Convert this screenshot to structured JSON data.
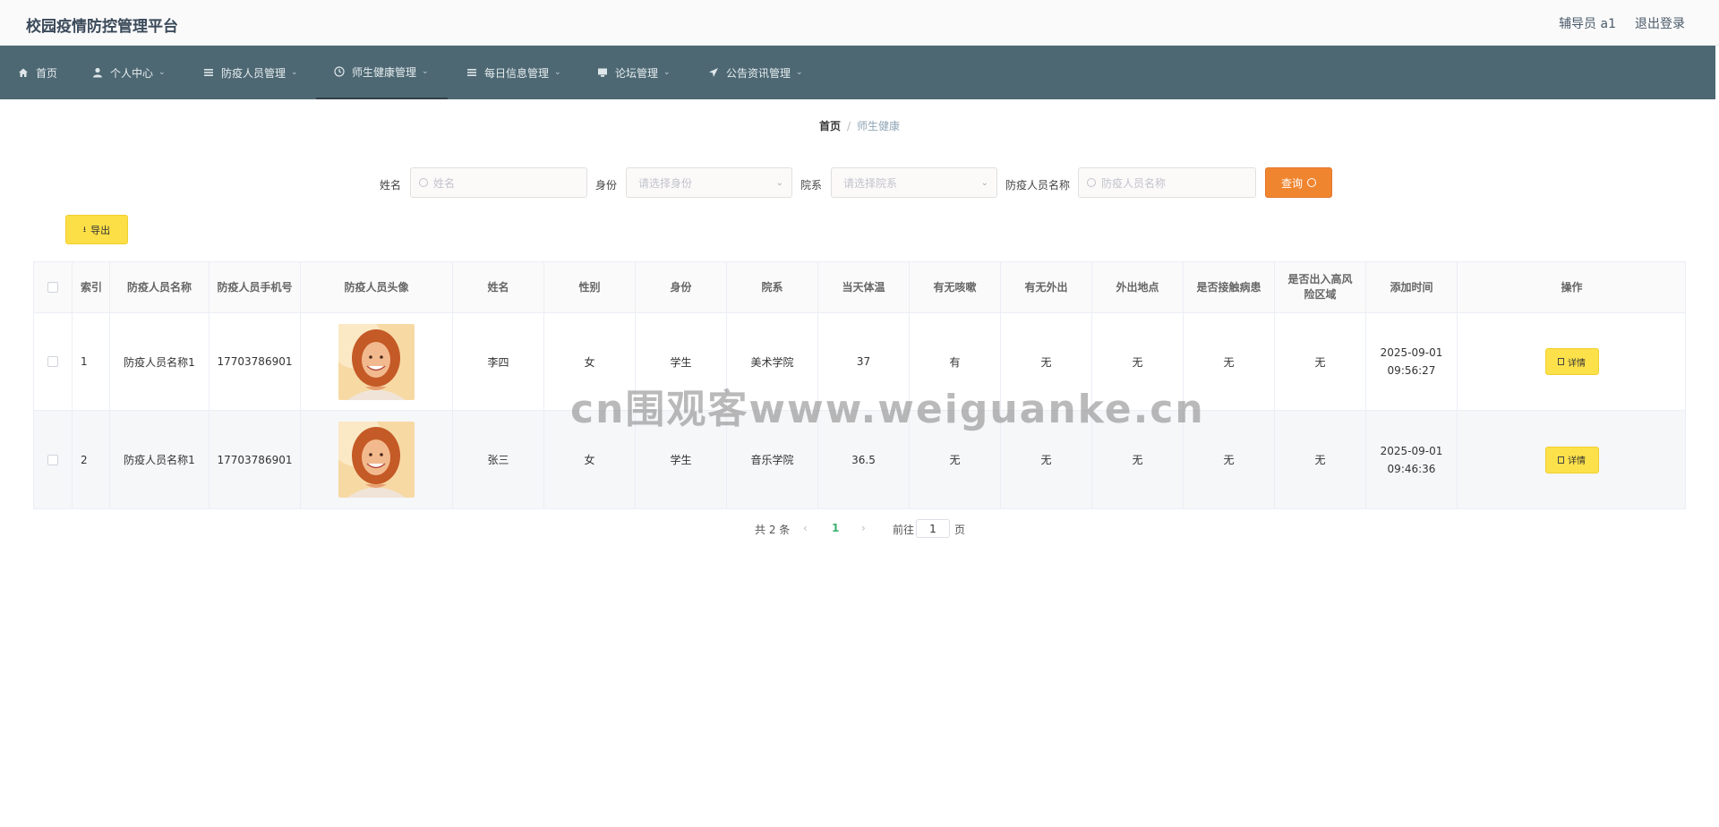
{
  "app": {
    "title": "校园疫情防控管理平台"
  },
  "header": {
    "user": "辅导员 a1",
    "logout": "退出登录"
  },
  "nav": {
    "items": [
      {
        "label": "首页",
        "icon": "home-icon"
      },
      {
        "label": "个人中心",
        "icon": "user-icon"
      },
      {
        "label": "防疫人员管理",
        "icon": "list-icon"
      },
      {
        "label": "师生健康管理",
        "icon": "clock-icon"
      },
      {
        "label": "每日信息管理",
        "icon": "list-icon"
      },
      {
        "label": "论坛管理",
        "icon": "monitor-icon"
      },
      {
        "label": "公告资讯管理",
        "icon": "send-icon"
      }
    ],
    "active_index": 3
  },
  "breadcrumb": {
    "home": "首页",
    "separator": "/",
    "current": "师生健康"
  },
  "search": {
    "name_label": "姓名",
    "name_placeholder": "姓名",
    "identity_label": "身份",
    "identity_placeholder": "请选择身份",
    "college_label": "院系",
    "college_placeholder": "请选择院系",
    "staff_label": "防疫人员名称",
    "staff_placeholder": "防疫人员名称",
    "query_button": "查询"
  },
  "toolbar": {
    "export_label": "导出"
  },
  "table": {
    "columns": [
      "索引",
      "防疫人员名称",
      "防疫人员手机号",
      "防疫人员头像",
      "姓名",
      "性别",
      "身份",
      "院系",
      "当天体温",
      "有无咳嗽",
      "有无外出",
      "外出地点",
      "是否接触病患",
      "是否出入高风险区域",
      "添加时间",
      "操作"
    ],
    "rows": [
      {
        "index": "1",
        "staff_name": "防疫人员名称1",
        "staff_phone": "17703786901",
        "name": "李四",
        "gender": "女",
        "identity": "学生",
        "college": "美术学院",
        "temperature": "37",
        "cough": "有",
        "went_out": "无",
        "out_location": "无",
        "contact_patient": "无",
        "high_risk": "无",
        "added_time": "2025-09-01 09:56:27",
        "action": "详情"
      },
      {
        "index": "2",
        "staff_name": "防疫人员名称1",
        "staff_phone": "17703786901",
        "name": "张三",
        "gender": "女",
        "identity": "学生",
        "college": "音乐学院",
        "temperature": "36.5",
        "cough": "无",
        "went_out": "无",
        "out_location": "无",
        "contact_patient": "无",
        "high_risk": "无",
        "added_time": "2025-09-01 09:46:36",
        "action": "详情"
      }
    ]
  },
  "pagination": {
    "total_text": "共 2 条",
    "current_page": "1",
    "goto_label": "前往",
    "goto_value": "1",
    "page_unit": "页"
  },
  "watermark": "cn围观客www.weiguanke.cn",
  "colors": {
    "nav_bg": "#4d6873",
    "query_button": "#f08530",
    "action_button": "#fce14a",
    "active_page": "#3cb371"
  }
}
